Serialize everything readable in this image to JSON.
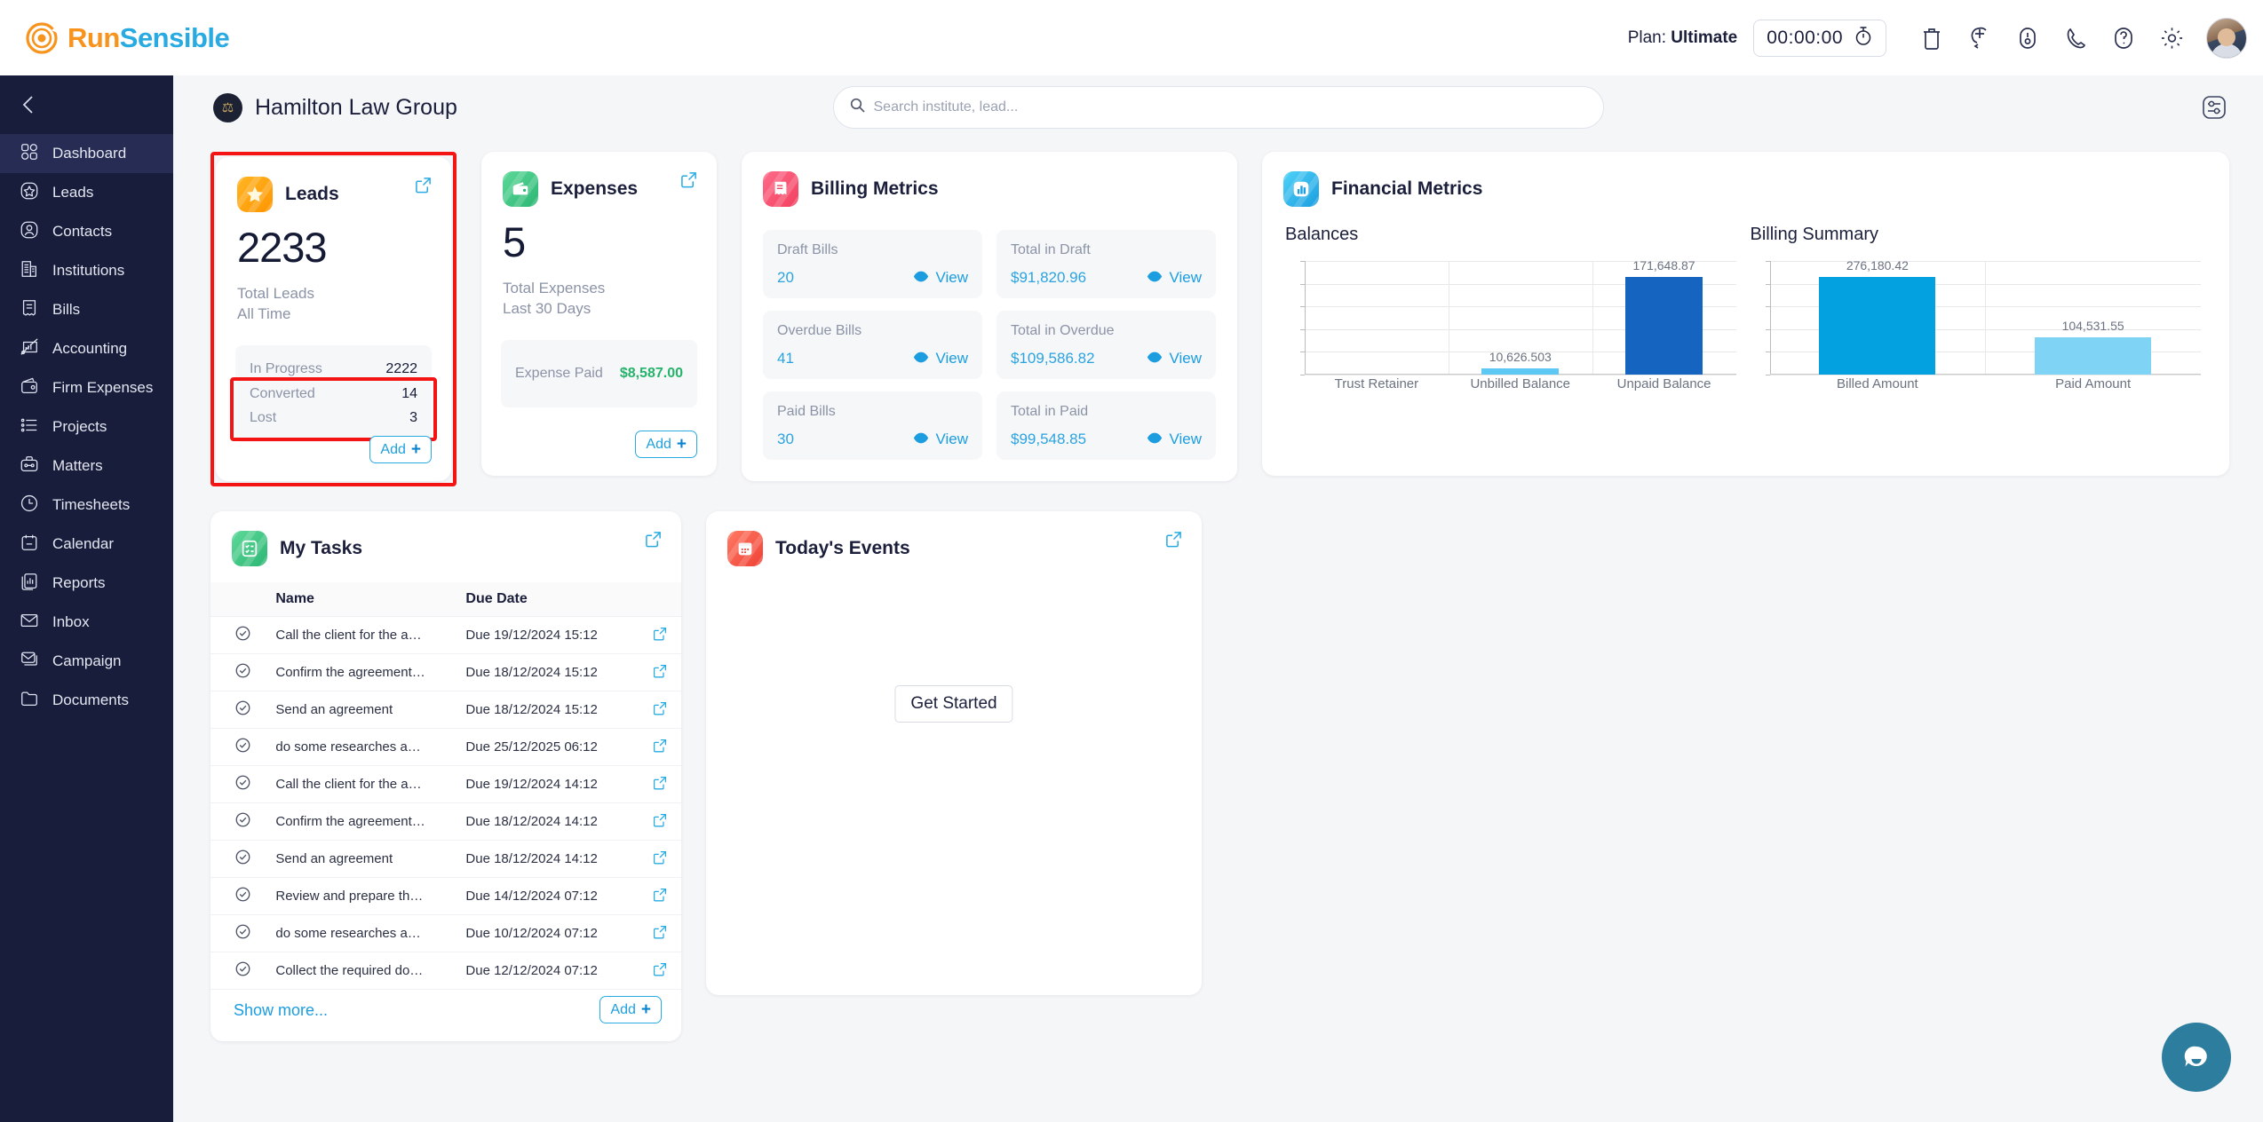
{
  "brand": {
    "name_part1": "Run",
    "name_part2": "Sensible",
    "color1": "#F7941E",
    "color2": "#29ABE2"
  },
  "header": {
    "plan_prefix": "Plan: ",
    "plan_value": "Ultimate",
    "timer": "00:00:00",
    "icons": [
      "stopwatch-icon",
      "trash-icon",
      "add-note-icon",
      "notification-icon",
      "phone-icon",
      "help-icon",
      "gear-icon",
      "avatar"
    ]
  },
  "sidebar": {
    "collapse_label": "collapse",
    "items": [
      {
        "label": "Dashboard",
        "icon": "grid-icon",
        "active": true
      },
      {
        "label": "Leads",
        "icon": "star-icon",
        "active": false
      },
      {
        "label": "Contacts",
        "icon": "user-icon",
        "active": false
      },
      {
        "label": "Institutions",
        "icon": "building-icon",
        "active": false
      },
      {
        "label": "Bills",
        "icon": "receipt-icon",
        "active": false
      },
      {
        "label": "Accounting",
        "icon": "chart-up-icon",
        "active": false
      },
      {
        "label": "Firm Expenses",
        "icon": "wallet-icon",
        "active": false
      },
      {
        "label": "Projects",
        "icon": "list-icon",
        "active": false
      },
      {
        "label": "Matters",
        "icon": "briefcase-icon",
        "active": false
      },
      {
        "label": "Timesheets",
        "icon": "clock-icon",
        "active": false
      },
      {
        "label": "Calendar",
        "icon": "calendar-icon",
        "active": false
      },
      {
        "label": "Reports",
        "icon": "reports-icon",
        "active": false
      },
      {
        "label": "Inbox",
        "icon": "envelope-icon",
        "active": false
      },
      {
        "label": "Campaign",
        "icon": "campaign-icon",
        "active": false
      },
      {
        "label": "Documents",
        "icon": "folder-icon",
        "active": false
      }
    ]
  },
  "page": {
    "firm_name": "Hamilton Law Group",
    "search_placeholder": "Search institute, lead...",
    "search_value": "",
    "settings_icon": "sliders-icon"
  },
  "leads_card": {
    "title": "Leads",
    "value": "2233",
    "subtitle_line1": "Total Leads",
    "subtitle_line2": "All Time",
    "breakdown": [
      {
        "label": "In Progress",
        "value": "2222"
      },
      {
        "label": "Converted",
        "value": "14"
      },
      {
        "label": "Lost",
        "value": "3"
      }
    ],
    "add_label": "Add",
    "highlight_color": "#f51414"
  },
  "expenses_card": {
    "title": "Expenses",
    "value": "5",
    "subtitle_line1": "Total Expenses",
    "subtitle_line2": "Last 30 Days",
    "breakdown": [
      {
        "label": "Expense Paid",
        "value": "$8,587.00"
      }
    ],
    "add_label": "Add"
  },
  "billing_metrics": {
    "title": "Billing Metrics",
    "view_label": "View",
    "tiles": [
      {
        "label": "Draft Bills",
        "value": "20"
      },
      {
        "label": "Total in Draft",
        "value": "$91,820.96"
      },
      {
        "label": "Overdue Bills",
        "value": "41"
      },
      {
        "label": "Total in Overdue",
        "value": "$109,586.82"
      },
      {
        "label": "Paid Bills",
        "value": "30"
      },
      {
        "label": "Total in Paid",
        "value": "$99,548.85"
      }
    ]
  },
  "financial_metrics": {
    "title": "Financial Metrics"
  },
  "chart_data": [
    {
      "type": "bar",
      "title": "Balances",
      "categories": [
        "Trust Retainer",
        "Unbilled Balance",
        "Unpaid Balance"
      ],
      "values": [
        0,
        10626.503,
        171648.87
      ],
      "value_labels": [
        "",
        "10,626.503",
        "171,648.87"
      ],
      "colors": [
        "#4fc3f7",
        "#5ec8f5",
        "#1565c0"
      ],
      "xlabel": "",
      "ylabel": "",
      "ylim": [
        0,
        200000
      ],
      "grid": true,
      "legend": "none"
    },
    {
      "type": "bar",
      "title": "Billing Summary",
      "categories": [
        "Billed Amount",
        "Paid Amount"
      ],
      "values": [
        276180.42,
        104531.55
      ],
      "value_labels": [
        "276,180.42",
        "104,531.55"
      ],
      "colors": [
        "#03a1e0",
        "#7fd4f5"
      ],
      "xlabel": "",
      "ylabel": "",
      "ylim": [
        0,
        320000
      ],
      "grid": true,
      "legend": "none"
    }
  ],
  "tasks_card": {
    "title": "My Tasks",
    "columns": [
      "",
      "Name",
      "Due Date",
      ""
    ],
    "rows": [
      {
        "name": "Call the client for the a…",
        "due": "Due 19/12/2024 15:12"
      },
      {
        "name": "Confirm the agreement…",
        "due": "Due 18/12/2024 15:12"
      },
      {
        "name": "Send an agreement",
        "due": "Due 18/12/2024 15:12"
      },
      {
        "name": "do some researches a…",
        "due": "Due 25/12/2025 06:12"
      },
      {
        "name": "Call the client for the a…",
        "due": "Due 19/12/2024 14:12"
      },
      {
        "name": "Confirm the agreement…",
        "due": "Due 18/12/2024 14:12"
      },
      {
        "name": "Send an agreement",
        "due": "Due 18/12/2024 14:12"
      },
      {
        "name": "Review and prepare th…",
        "due": "Due 14/12/2024 07:12"
      },
      {
        "name": "do some researches a…",
        "due": "Due 10/12/2024 07:12"
      },
      {
        "name": "Collect the required do…",
        "due": "Due 12/12/2024 07:12"
      }
    ],
    "show_more_label": "Show more...",
    "add_label": "Add"
  },
  "events_card": {
    "title": "Today's Events",
    "get_started_label": "Get Started"
  },
  "chat": {
    "icon": "chat-bubble-icon"
  }
}
